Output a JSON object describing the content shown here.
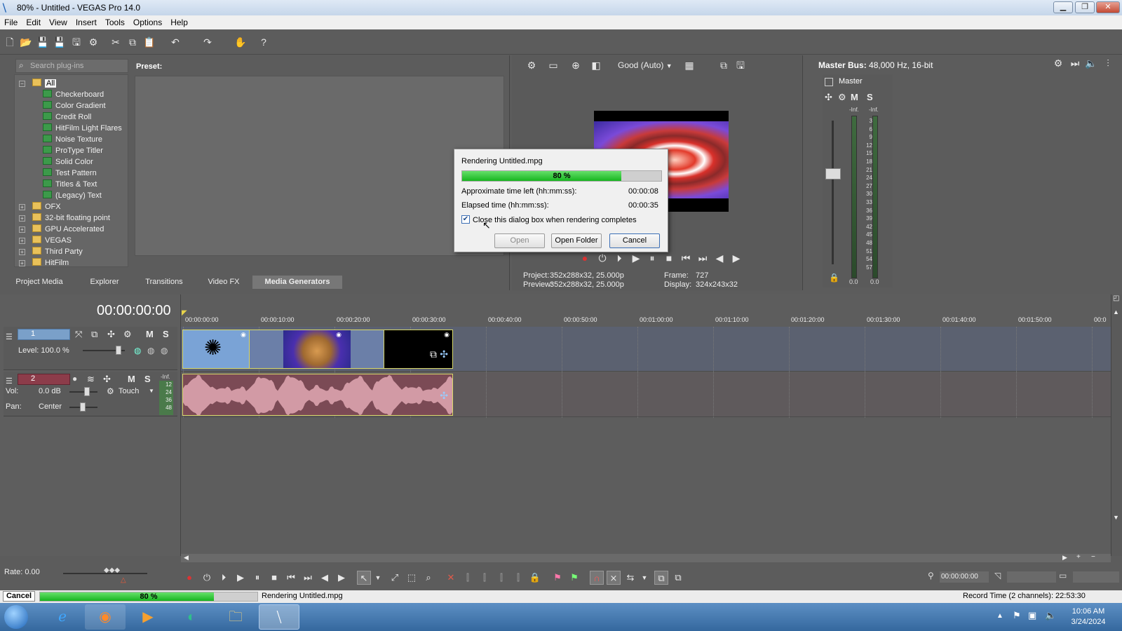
{
  "window": {
    "title": "80% - Untitled - VEGAS Pro 14.0"
  },
  "menu": [
    "File",
    "Edit",
    "View",
    "Insert",
    "Tools",
    "Options",
    "Help"
  ],
  "plugins": {
    "search_placeholder": "Search plug-ins",
    "preset_label": "Preset:",
    "root": "All",
    "generators": [
      "Checkerboard",
      "Color Gradient",
      "Credit Roll",
      "HitFilm Light Flares",
      "Noise Texture",
      "ProType Titler",
      "Solid Color",
      "Test Pattern",
      "Titles & Text",
      "(Legacy) Text"
    ],
    "folders": [
      "OFX",
      "32-bit floating point",
      "GPU Accelerated",
      "VEGAS",
      "Third Party",
      "HitFilm"
    ]
  },
  "tabs": [
    "Project Media",
    "Explorer",
    "Transitions",
    "Video FX",
    "Media Generators"
  ],
  "preview": {
    "quality": "Good (Auto)",
    "project_label": "Project:",
    "project_value": "352x288x32, 25.000p",
    "preview_label": "Preview:",
    "preview_value": "352x288x32, 25.000p",
    "frame_label": "Frame:",
    "frame_value": "727",
    "display_label": "Display:",
    "display_value": "324x243x32"
  },
  "render_dialog": {
    "title": "Rendering Untitled.mpg",
    "progress": 0.8,
    "progress_label": "80 %",
    "time_left_label": "Approximate time left (hh:mm:ss):",
    "time_left": "00:00:08",
    "elapsed_label": "Elapsed time (hh:mm:ss):",
    "elapsed": "00:00:35",
    "close_checkbox_label": "Close this dialog box when rendering completes",
    "close_checked": true,
    "open_button": "Open",
    "open_folder_button": "Open Folder",
    "cancel_button": "Cancel"
  },
  "master": {
    "title": "Master Bus:",
    "info": "48,000 Hz, 16-bit",
    "name": "Master",
    "m": "M",
    "s": "S",
    "inf_left": "-Inf.",
    "inf_right": "-Inf.",
    "scale": [
      "3",
      "6",
      "9",
      "12",
      "15",
      "18",
      "21",
      "24",
      "27",
      "30",
      "33",
      "36",
      "39",
      "42",
      "45",
      "48",
      "51",
      "54",
      "57"
    ],
    "bottom_left": "0.0",
    "bottom_right": "0.0"
  },
  "timeline": {
    "timecode": "00:00:00:00",
    "ruler": [
      "00:00:00:00",
      "00:00:10:00",
      "00:00:20:00",
      "00:00:30:00",
      "00:00:40:00",
      "00:00:50:00",
      "00:01:00:00",
      "00:01:10:00",
      "00:01:20:00",
      "00:01:30:00",
      "00:01:40:00",
      "00:01:50:00",
      "00:0"
    ],
    "video_track": {
      "number": "1",
      "level": "Level: 100.0 %",
      "m": "M",
      "s": "S"
    },
    "audio_track": {
      "number": "2",
      "vol_label": "Vol:",
      "vol_value": "0.0 dB",
      "automation": "Touch",
      "pan_label": "Pan:",
      "pan_value": "Center",
      "m": "M",
      "s": "S",
      "meter_top": "-Inf.",
      "meter_scale": [
        "12",
        "24",
        "36",
        "48"
      ]
    },
    "rate": "Rate: 0.00",
    "cursor_time": "00:00:00:00"
  },
  "status": {
    "cancel_button": "Cancel",
    "progress": 0.8,
    "progress_label": "80 %",
    "message": "Rendering Untitled.mpg",
    "record_time": "Record Time (2 channels): 22:53:30"
  },
  "taskbar": {
    "time": "10:06 AM",
    "date": "3/24/2024"
  },
  "colors": {
    "progress_green": "#17b520",
    "clip_border": "#d8d86a",
    "audio_clip": "#7b4a55"
  }
}
